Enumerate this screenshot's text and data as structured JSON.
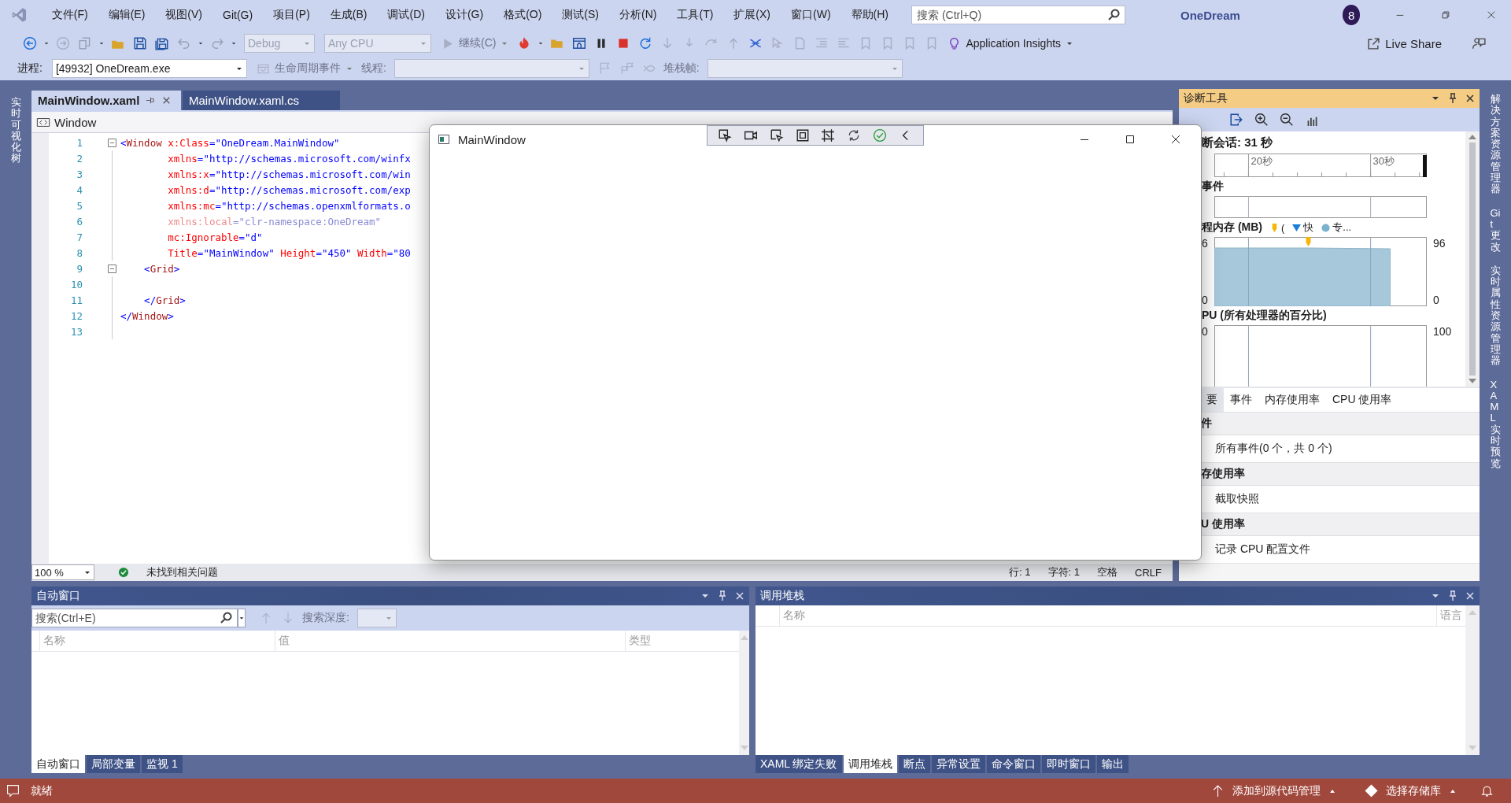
{
  "title_bar": {
    "menu": [
      "文件(F)",
      "编辑(E)",
      "视图(V)",
      "Git(G)",
      "项目(P)",
      "生成(B)",
      "调试(D)",
      "设计(G)",
      "格式(O)",
      "测试(S)",
      "分析(N)",
      "工具(T)",
      "扩展(X)",
      "窗口(W)",
      "帮助(H)"
    ],
    "search": {
      "placeholder": "搜索 (Ctrl+Q)"
    },
    "solution_name": "OneDream",
    "account_badge": "8"
  },
  "toolbar": {
    "configuration": {
      "value": "Debug",
      "disabled": true
    },
    "platform": {
      "value": "Any CPU",
      "disabled": true
    },
    "continue_label": "继续(C)",
    "insights_label": "Application Insights",
    "live_share": "Live Share"
  },
  "debug_location": {
    "process_label": "进程:",
    "process": "[49932] OneDream.exe",
    "lifecycle_label": "生命周期事件",
    "thread_label": "线程:",
    "stack_frame_label": "堆栈帧:"
  },
  "left_side_tabs": [
    "实时可视化树"
  ],
  "right_side_tabs": [
    "解决方案资源管理器",
    "Git 更改",
    "实时属性资源管理器",
    "XAML 实时预览"
  ],
  "editor": {
    "tabs": [
      {
        "label": "MainWindow.xaml",
        "selected": true
      },
      {
        "label": "MainWindow.xaml.cs",
        "selected": false
      }
    ],
    "breadcrumb": "Window",
    "lines": [
      {
        "number": "1",
        "folding_marker": true,
        "tokens": [
          {
            "kind": "punct",
            "text": "<"
          },
          {
            "kind": "element",
            "text": "Window"
          },
          {
            "kind": "attr",
            "text": " x:Class"
          },
          {
            "kind": "punct",
            "text": "="
          },
          {
            "kind": "value",
            "text": "\"OneDream.MainWindow\""
          }
        ]
      },
      {
        "number": "2",
        "folding_marker": false,
        "tokens": [
          {
            "kind": "attr",
            "text": "        xmlns"
          },
          {
            "kind": "punct",
            "text": "="
          },
          {
            "kind": "value",
            "text": "\"http://schemas.microsoft.com/winfx"
          }
        ]
      },
      {
        "number": "3",
        "folding_marker": false,
        "tokens": [
          {
            "kind": "attr",
            "text": "        xmlns:x"
          },
          {
            "kind": "punct",
            "text": "="
          },
          {
            "kind": "value",
            "text": "\"http://schemas.microsoft.com/win"
          }
        ]
      },
      {
        "number": "4",
        "folding_marker": false,
        "tokens": [
          {
            "kind": "attr",
            "text": "        xmlns:d"
          },
          {
            "kind": "punct",
            "text": "="
          },
          {
            "kind": "value",
            "text": "\"http://schemas.microsoft.com/exp"
          }
        ]
      },
      {
        "number": "5",
        "folding_marker": false,
        "tokens": [
          {
            "kind": "attr",
            "text": "        xmlns:mc"
          },
          {
            "kind": "punct",
            "text": "="
          },
          {
            "kind": "value",
            "text": "\"http://schemas.openxmlformats.o"
          }
        ]
      },
      {
        "number": "6",
        "folding_marker": false,
        "tokens": [
          {
            "kind": "attr_dim",
            "text": "        xmlns:local"
          },
          {
            "kind": "value_dim",
            "text": "=\"clr-namespace:OneDream\""
          }
        ]
      },
      {
        "number": "7",
        "folding_marker": false,
        "tokens": [
          {
            "kind": "attr",
            "text": "        mc:Ignorable"
          },
          {
            "kind": "punct",
            "text": "="
          },
          {
            "kind": "value",
            "text": "\"d\""
          }
        ]
      },
      {
        "number": "8",
        "folding_marker": false,
        "tokens": [
          {
            "kind": "attr",
            "text": "        Title"
          },
          {
            "kind": "punct",
            "text": "="
          },
          {
            "kind": "value",
            "text": "\"MainWindow\""
          },
          {
            "kind": "attr",
            "text": " Height"
          },
          {
            "kind": "punct",
            "text": "="
          },
          {
            "kind": "value",
            "text": "\"450\""
          },
          {
            "kind": "attr",
            "text": " Width"
          },
          {
            "kind": "punct",
            "text": "="
          },
          {
            "kind": "value",
            "text": "\"80"
          }
        ]
      },
      {
        "number": "9",
        "folding_marker": true,
        "tokens": [
          {
            "kind": "punct",
            "text": "    <"
          },
          {
            "kind": "element",
            "text": "Grid"
          },
          {
            "kind": "punct",
            "text": ">"
          }
        ]
      },
      {
        "number": "10",
        "folding_marker": false
      },
      {
        "number": "11",
        "folding_marker": false,
        "tokens": [
          {
            "kind": "punct",
            "text": "    </"
          },
          {
            "kind": "element",
            "text": "Grid"
          },
          {
            "kind": "punct",
            "text": ">"
          }
        ]
      },
      {
        "number": "12",
        "folding_marker": false,
        "tokens": [
          {
            "kind": "punct",
            "text": "</"
          },
          {
            "kind": "element",
            "text": "Window"
          },
          {
            "kind": "punct",
            "text": ">"
          }
        ]
      },
      {
        "number": "13",
        "folding_marker": false
      }
    ],
    "zoom": "100 %",
    "issues": "未找到相关问题",
    "line": "行: 1",
    "column": "字符: 1",
    "spacing": "空格",
    "line_ending": "CRLF"
  },
  "diagnostics": {
    "title": "诊断工具",
    "session": "断会话: 31 秒",
    "events_title": "事件",
    "memory_title": "程内存 (MB)",
    "legend": [
      {
        "kind": "gc",
        "label": "(",
        "color": "#f5b50a"
      },
      {
        "kind": "snapshot",
        "label": "快",
        "color": "#1b7fd8"
      },
      {
        "kind": "private_bytes",
        "label": "专...",
        "color": "#7ab2cf"
      }
    ],
    "ruler_ticks": [
      "20秒",
      "30秒"
    ],
    "memory_left_labels": [
      "6",
      "0"
    ],
    "memory_right_labels": [
      "96",
      "0"
    ],
    "cpu_title": "PU (所有处理器的百分比)",
    "cpu_left_label": "0",
    "cpu_right_label": "100",
    "tabs": [
      {
        "label": "要",
        "selected": true
      },
      {
        "label": "事件",
        "selected": false
      },
      {
        "label": "内存使用率",
        "selected": false
      },
      {
        "label": "CPU 使用率",
        "selected": false
      }
    ],
    "sections": [
      {
        "title": "件",
        "action": "所有事件(0 个，共 0 个)"
      },
      {
        "title": "存使用率",
        "action": "截取快照"
      },
      {
        "title": "U 使用率",
        "action": "记录 CPU 配置文件"
      }
    ]
  },
  "autos": {
    "title": "自动窗口",
    "search": {
      "placeholder": "搜索(Ctrl+E)"
    },
    "depth_label": "搜索深度:",
    "columns": [
      "名称",
      "值",
      "类型"
    ],
    "tabs": [
      {
        "label": "自动窗口",
        "selected": true
      },
      {
        "label": "局部变量",
        "selected": false
      },
      {
        "label": "监视 1",
        "selected": false
      }
    ]
  },
  "call_stack": {
    "title": "调用堆栈",
    "columns": [
      "名称",
      "语言"
    ],
    "tabs": [
      {
        "label": "XAML 绑定失败",
        "selected": false
      },
      {
        "label": "调用堆栈",
        "selected": true
      },
      {
        "label": "断点",
        "selected": false
      },
      {
        "label": "异常设置",
        "selected": false
      },
      {
        "label": "命令窗口",
        "selected": false
      },
      {
        "label": "即时窗口",
        "selected": false
      },
      {
        "label": "输出",
        "selected": false
      }
    ]
  },
  "status_bar": {
    "status": "就绪",
    "add_to_source_control": "添加到源代码管理",
    "select_repository": "选择存储库"
  },
  "app_window": {
    "title": "MainWindow"
  }
}
